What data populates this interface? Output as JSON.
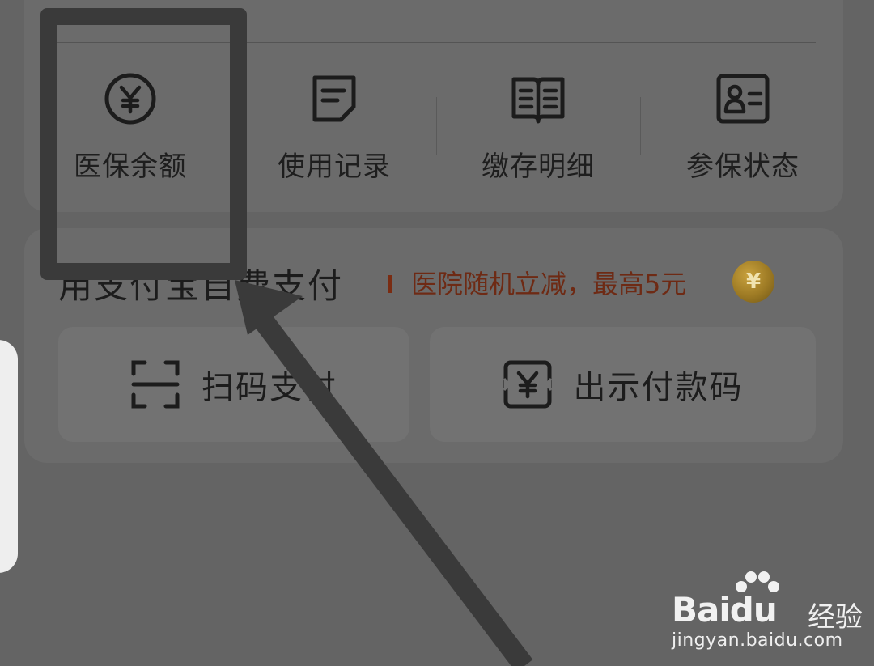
{
  "services": [
    {
      "label": "医保余额",
      "icon": "yuan-circle-icon"
    },
    {
      "label": "使用记录",
      "icon": "document-icon"
    },
    {
      "label": "缴存明细",
      "icon": "open-book-icon"
    },
    {
      "label": "参保状态",
      "icon": "id-card-icon"
    }
  ],
  "payment": {
    "title": "用支付宝自费支付",
    "promo": "医院随机立减，最高5元",
    "coin_symbol": "¥",
    "scan_label": "扫码支付",
    "show_code_label": "出示付款码"
  },
  "watermark": {
    "brand_a": "Bai",
    "brand_b": "du",
    "jingyan": "经验",
    "url": "jingyan.baidu.com"
  },
  "colors": {
    "overlay_bg": "#646464",
    "promo_red": "#6e2a14",
    "highlight": "#3a3a3a"
  }
}
